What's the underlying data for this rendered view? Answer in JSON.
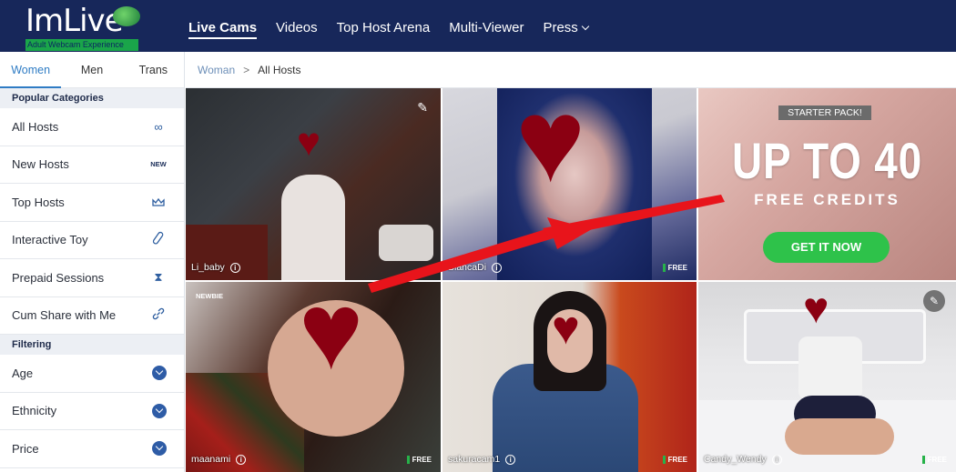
{
  "brand": {
    "name": "ImLive",
    "tagline": "Adult Webcam Experience"
  },
  "nav": [
    {
      "label": "Live Cams",
      "active": true
    },
    {
      "label": "Videos"
    },
    {
      "label": "Top Host Arena"
    },
    {
      "label": "Multi-Viewer"
    },
    {
      "label": "Press"
    }
  ],
  "gender_tabs": [
    "Women",
    "Men",
    "Trans"
  ],
  "sidebar": {
    "categories_title": "Popular Categories",
    "categories": [
      {
        "label": "All Hosts",
        "icon": "infinity-icon"
      },
      {
        "label": "New Hosts",
        "icon": "new-icon",
        "icon_text": "NEW"
      },
      {
        "label": "Top Hosts",
        "icon": "crown-icon"
      },
      {
        "label": "Interactive Toy",
        "icon": "toy-icon"
      },
      {
        "label": "Prepaid Sessions",
        "icon": "hourglass-icon"
      },
      {
        "label": "Cum Share with Me",
        "icon": "link-icon"
      }
    ],
    "filtering_title": "Filtering",
    "filters": [
      {
        "label": "Age"
      },
      {
        "label": "Ethnicity"
      },
      {
        "label": "Price"
      }
    ]
  },
  "breadcrumb": {
    "parent": "Woman",
    "separator": ">",
    "current": "All Hosts"
  },
  "tiles": [
    {
      "name": "Li_baby",
      "free": false
    },
    {
      "name": "BlancaDi",
      "free": true
    },
    {
      "name": "maanami",
      "free": true,
      "newbie": "NEWBIE"
    },
    {
      "name": "sakuracam1",
      "free": true
    },
    {
      "name": "Candy_Wendy",
      "free": true
    }
  ],
  "free_label": "FREE",
  "promo": {
    "badge": "STARTER PACK!",
    "headline": "UP TO 40",
    "subline": "FREE CREDITS",
    "button": "GET IT NOW"
  },
  "colors": {
    "header_bg": "#17275a",
    "accent_blue": "#2f7cc4",
    "promo_button": "#2ec24a",
    "annotation_arrow": "#e8141b"
  }
}
